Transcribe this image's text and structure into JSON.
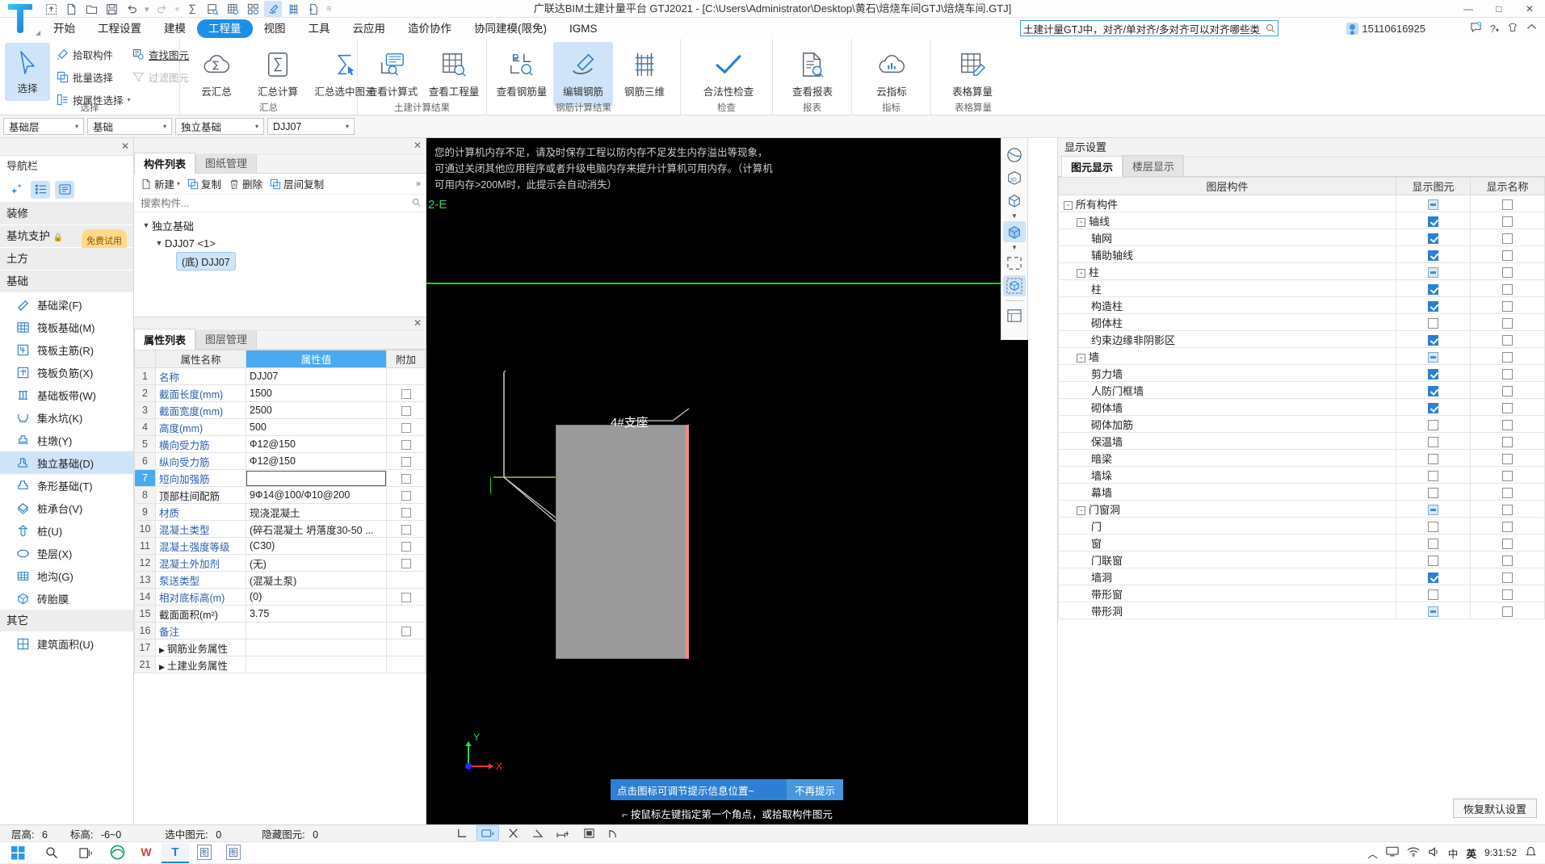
{
  "window": {
    "title": "广联达BIM土建计量平台 GTJ2021 - [C:\\Users\\Administrator\\Desktop\\黄石\\焙烧车间GTJ\\焙烧车间.GTJ]",
    "minimize": "—",
    "maximize": "□",
    "close": "✕"
  },
  "quick_access": {
    "icons": [
      "upload-icon",
      "new-file-icon",
      "open-folder-icon",
      "save-icon",
      "undo-icon",
      "redo-icon",
      "sum-icon",
      "calc-check-icon",
      "grid-search-icon",
      "layout-search-icon",
      "edit-rebar-icon",
      "rebar-3d-icon",
      "add-sheet-icon",
      "qat-more-icon"
    ]
  },
  "menu": {
    "items": [
      {
        "label": "开始",
        "active": false
      },
      {
        "label": "工程设置",
        "active": false
      },
      {
        "label": "建模",
        "active": false
      },
      {
        "label": "工程量",
        "active": true
      },
      {
        "label": "视图",
        "active": false
      },
      {
        "label": "工具",
        "active": false
      },
      {
        "label": "云应用",
        "active": false
      },
      {
        "label": "造价协作",
        "active": false
      },
      {
        "label": "协同建模(限免)",
        "active": false
      },
      {
        "label": "IGMS",
        "active": false
      }
    ]
  },
  "search": {
    "value": "土建计量GTJ中，对齐/单对齐/多对齐可以对齐哪些类型",
    "placeholder": "搜索"
  },
  "account": {
    "user_id": "15110616925"
  },
  "top_right_icons": [
    "message-icon",
    "help-icon",
    "shirt-icon",
    "collapse-ribbon-icon"
  ],
  "ribbon": {
    "groups": [
      {
        "title": "选择",
        "main": {
          "label": "选择",
          "icon": "cursor-arrow-icon",
          "selected": true
        },
        "items": [
          {
            "label": "拾取构件",
            "icon": "pick-component-icon",
            "disabled": false
          },
          {
            "label": "批量选择",
            "icon": "batch-select-icon",
            "disabled": false
          },
          {
            "label": "按属性选择",
            "icon": "select-by-property-icon",
            "disabled": false,
            "dropdown": true
          },
          {
            "label": "查找图元",
            "icon": "find-element-icon",
            "disabled": false
          },
          {
            "label": "过滤图元",
            "icon": "filter-element-icon",
            "disabled": true
          }
        ]
      },
      {
        "title": "汇总",
        "buttons": [
          {
            "label": "云汇总",
            "icon": "cloud-sum-icon",
            "selected": false
          },
          {
            "label": "汇总计算",
            "icon": "sum-calc-icon",
            "selected": false
          },
          {
            "label": "汇总选中图元",
            "icon": "sum-selected-icon",
            "selected": false
          }
        ]
      },
      {
        "title": "土建计算结果",
        "buttons": [
          {
            "label": "查看计算式",
            "icon": "view-formula-icon",
            "selected": false
          },
          {
            "label": "查看工程量",
            "icon": "view-quantity-icon",
            "selected": false
          }
        ]
      },
      {
        "title": "钢筋计算结果",
        "buttons": [
          {
            "label": "查看钢筋量",
            "icon": "view-rebar-qty-icon",
            "selected": false
          },
          {
            "label": "编辑钢筋",
            "icon": "edit-rebar-icon",
            "selected": true
          },
          {
            "label": "钢筋三维",
            "icon": "rebar-3d-icon",
            "selected": false
          }
        ]
      },
      {
        "title": "检查",
        "buttons": [
          {
            "label": "合法性检查",
            "icon": "check-mark-icon",
            "selected": false
          }
        ]
      },
      {
        "title": "报表",
        "buttons": [
          {
            "label": "查看报表",
            "icon": "view-report-icon",
            "selected": false
          }
        ]
      },
      {
        "title": "指标",
        "buttons": [
          {
            "label": "云指标",
            "icon": "cloud-indicator-icon",
            "selected": false
          }
        ]
      },
      {
        "title": "表格算量",
        "buttons": [
          {
            "label": "表格算量",
            "icon": "table-quantity-icon",
            "selected": false
          }
        ]
      }
    ]
  },
  "filter_bar": {
    "combos": [
      {
        "name": "floor",
        "value": "基础层"
      },
      {
        "name": "category",
        "value": "基础"
      },
      {
        "name": "component-type",
        "value": "独立基础"
      },
      {
        "name": "component-name",
        "value": "DJJ07"
      }
    ]
  },
  "nav_panel": {
    "title": "导航栏",
    "tools": [
      "sparkle-icon",
      "list-view-icon",
      "detail-view-icon"
    ],
    "groups": [
      {
        "label": "装修",
        "items": []
      },
      {
        "label": "基坑支护",
        "lock": true,
        "badge": "免费试用",
        "items": []
      },
      {
        "label": "土方",
        "items": []
      },
      {
        "label": "基础",
        "items": [
          {
            "label": "基础梁(F)",
            "icon": "foundation-beam-icon",
            "active": false
          },
          {
            "label": "筏板基础(M)",
            "icon": "raft-foundation-icon",
            "active": false
          },
          {
            "label": "筏板主筋(R)",
            "icon": "raft-main-rebar-icon",
            "active": false
          },
          {
            "label": "筏板负筋(X)",
            "icon": "raft-negative-rebar-icon",
            "active": false
          },
          {
            "label": "基础板带(W)",
            "icon": "foundation-slab-band-icon",
            "active": false
          },
          {
            "label": "集水坑(K)",
            "icon": "sump-pit-icon",
            "active": false
          },
          {
            "label": "柱墩(Y)",
            "icon": "column-pier-icon",
            "active": false
          },
          {
            "label": "独立基础(D)",
            "icon": "isolated-foundation-icon",
            "active": true
          },
          {
            "label": "条形基础(T)",
            "icon": "strip-foundation-icon",
            "active": false
          },
          {
            "label": "桩承台(V)",
            "icon": "pile-cap-icon",
            "active": false
          },
          {
            "label": "桩(U)",
            "icon": "pile-icon",
            "active": false
          },
          {
            "label": "垫层(X)",
            "icon": "cushion-layer-icon",
            "active": false
          },
          {
            "label": "地沟(G)",
            "icon": "trench-icon",
            "active": false
          },
          {
            "label": "砖胎膜",
            "icon": "brick-formwork-icon",
            "active": false
          }
        ]
      },
      {
        "label": "其它",
        "items": [
          {
            "label": "建筑面积(U)",
            "icon": "building-area-icon",
            "active": false
          }
        ]
      }
    ]
  },
  "component_panel": {
    "tabs": [
      {
        "label": "构件列表",
        "active": true
      },
      {
        "label": "图纸管理",
        "active": false
      }
    ],
    "toolbar": [
      {
        "label": "新建",
        "icon": "new-icon",
        "dropdown": true
      },
      {
        "label": "复制",
        "icon": "copy-icon"
      },
      {
        "label": "删除",
        "icon": "delete-icon"
      },
      {
        "label": "层间复制",
        "icon": "copy-between-floors-icon"
      }
    ],
    "search_placeholder": "搜索构件...",
    "tree": [
      {
        "label": "独立基础",
        "level": 0,
        "expanded": true
      },
      {
        "label": "DJJ07 <1>",
        "level": 1,
        "expanded": true
      },
      {
        "label": "(底) DJJ07",
        "level": 2,
        "selected": true
      }
    ]
  },
  "property_panel": {
    "tabs": [
      {
        "label": "属性列表",
        "active": true
      },
      {
        "label": "图层管理",
        "active": false
      }
    ],
    "headers": [
      "",
      "属性名称",
      "属性值",
      "附加"
    ],
    "rows": [
      {
        "idx": "1",
        "name": "名称",
        "value": "DJJ07",
        "attach": false,
        "show_attach": false,
        "bold_name": false
      },
      {
        "idx": "2",
        "name": "截面长度(mm)",
        "value": "1500",
        "attach": false,
        "show_attach": true
      },
      {
        "idx": "3",
        "name": "截面宽度(mm)",
        "value": "2500",
        "attach": false,
        "show_attach": true
      },
      {
        "idx": "4",
        "name": "高度(mm)",
        "value": "500",
        "attach": false,
        "show_attach": true
      },
      {
        "idx": "5",
        "name": "横向受力筋",
        "value": "Ф12@150",
        "attach": false,
        "show_attach": true
      },
      {
        "idx": "6",
        "name": "纵向受力筋",
        "value": "Ф12@150",
        "attach": false,
        "show_attach": true
      },
      {
        "idx": "7",
        "name": "短向加强筋",
        "value": "",
        "attach": false,
        "show_attach": true,
        "selected": true,
        "editing": true
      },
      {
        "idx": "8",
        "name": "顶部柱间配筋",
        "value": "9Ф14@100/Ф10@200",
        "attach": false,
        "show_attach": true,
        "plain": true
      },
      {
        "idx": "9",
        "name": "材质",
        "value": "现浇混凝土",
        "attach": false,
        "show_attach": true
      },
      {
        "idx": "10",
        "name": "混凝土类型",
        "value": "(碎石混凝土 坍落度30-50 ...",
        "attach": false,
        "show_attach": true
      },
      {
        "idx": "11",
        "name": "混凝土强度等级",
        "value": "(C30)",
        "attach": false,
        "show_attach": true
      },
      {
        "idx": "12",
        "name": "混凝土外加剂",
        "value": "(无)",
        "attach": false,
        "show_attach": true
      },
      {
        "idx": "13",
        "name": "泵送类型",
        "value": "(混凝土泵)",
        "attach": false,
        "show_attach": false
      },
      {
        "idx": "14",
        "name": "相对底标高(m)",
        "value": "(0)",
        "attach": false,
        "show_attach": true
      },
      {
        "idx": "15",
        "name": "截面面积(m²)",
        "value": "3.75",
        "attach": false,
        "show_attach": false,
        "plain": true
      },
      {
        "idx": "16",
        "name": "备注",
        "value": "",
        "attach": false,
        "show_attach": true
      },
      {
        "idx": "17",
        "name": "钢筋业务属性",
        "value": "",
        "attach": false,
        "show_attach": false,
        "group": true
      },
      {
        "idx": "21",
        "name": "土建业务属性",
        "value": "",
        "attach": false,
        "show_attach": false,
        "group": true
      }
    ]
  },
  "canvas": {
    "memory_warning": "您的计算机内存不足，请及时保存工程以防内存不足发生内存溢出等现象，可通过关闭其他应用程序或者升级电脑内存来提升计算机可用内存。（计算机可用内存>200M时，此提示会自动消失）",
    "axis_label": "2-E",
    "annotation": "4#支座",
    "axis_x": "X",
    "axis_y": "Y",
    "tip_text": "点击图标可调节提示信息位置~",
    "tip_dismiss": "不再提示",
    "status_hint": "按鼠标左键指定第一个角点，或拾取构件图元"
  },
  "view_tools": {
    "items": [
      {
        "icon": "orbit-icon",
        "on": false
      },
      {
        "icon": "view-3d-icon",
        "on": false
      },
      {
        "icon": "cube-outline-icon",
        "on": false
      },
      {
        "icon": "caret-down-icon",
        "on": false,
        "caret": true
      },
      {
        "icon": "cube-filled-icon",
        "on": true
      },
      {
        "icon": "caret-down-icon",
        "on": false,
        "caret": true
      },
      {
        "icon": "select-region-icon",
        "on": false
      },
      {
        "icon": "cube-dashed-icon",
        "on": true
      },
      {
        "icon": "list-panel-icon",
        "on": false
      }
    ]
  },
  "display_settings": {
    "title": "显示设置",
    "tabs": [
      {
        "label": "图元显示",
        "active": true
      },
      {
        "label": "楼层显示",
        "active": false
      }
    ],
    "headers": [
      "图层构件",
      "显示图元",
      "显示名称"
    ],
    "rows": [
      {
        "label": "所有构件",
        "level": 0,
        "toggle": "-",
        "show_element": "half",
        "show_name": "off"
      },
      {
        "label": "轴线",
        "level": 1,
        "toggle": "-",
        "show_element": "on",
        "show_name": "off"
      },
      {
        "label": "轴网",
        "level": 2,
        "toggle": "",
        "show_element": "on",
        "show_name": "off"
      },
      {
        "label": "辅助轴线",
        "level": 2,
        "toggle": "",
        "show_element": "on",
        "show_name": "off"
      },
      {
        "label": "柱",
        "level": 1,
        "toggle": "-",
        "show_element": "half",
        "show_name": "off"
      },
      {
        "label": "柱",
        "level": 2,
        "toggle": "",
        "show_element": "on",
        "show_name": "off"
      },
      {
        "label": "构造柱",
        "level": 2,
        "toggle": "",
        "show_element": "on",
        "show_name": "off"
      },
      {
        "label": "砌体柱",
        "level": 2,
        "toggle": "",
        "show_element": "off",
        "show_name": "off"
      },
      {
        "label": "约束边缘非阴影区",
        "level": 2,
        "toggle": "",
        "show_element": "on",
        "show_name": "off"
      },
      {
        "label": "墙",
        "level": 1,
        "toggle": "-",
        "show_element": "half",
        "show_name": "off"
      },
      {
        "label": "剪力墙",
        "level": 2,
        "toggle": "",
        "show_element": "on",
        "show_name": "off"
      },
      {
        "label": "人防门框墙",
        "level": 2,
        "toggle": "",
        "show_element": "on",
        "show_name": "off"
      },
      {
        "label": "砌体墙",
        "level": 2,
        "toggle": "",
        "show_element": "on",
        "show_name": "off"
      },
      {
        "label": "砌体加筋",
        "level": 2,
        "toggle": "",
        "show_element": "off",
        "show_name": "off"
      },
      {
        "label": "保温墙",
        "level": 2,
        "toggle": "",
        "show_element": "off",
        "show_name": "off"
      },
      {
        "label": "暗梁",
        "level": 2,
        "toggle": "",
        "show_element": "off",
        "show_name": "off"
      },
      {
        "label": "墙垛",
        "level": 2,
        "toggle": "",
        "show_element": "off",
        "show_name": "off"
      },
      {
        "label": "幕墙",
        "level": 2,
        "toggle": "",
        "show_element": "off",
        "show_name": "off"
      },
      {
        "label": "门窗洞",
        "level": 1,
        "toggle": "-",
        "show_element": "half",
        "show_name": "off"
      },
      {
        "label": "门",
        "level": 2,
        "toggle": "",
        "show_element": "off",
        "show_name": "off"
      },
      {
        "label": "窗",
        "level": 2,
        "toggle": "",
        "show_element": "off",
        "show_name": "off"
      },
      {
        "label": "门联窗",
        "level": 2,
        "toggle": "",
        "show_element": "off",
        "show_name": "off"
      },
      {
        "label": "墙洞",
        "level": 2,
        "toggle": "",
        "show_element": "on",
        "show_name": "off"
      },
      {
        "label": "带形窗",
        "level": 2,
        "toggle": "",
        "show_element": "off",
        "show_name": "off"
      },
      {
        "label": "带形洞",
        "level": 2,
        "toggle": "",
        "show_element": "half",
        "show_name": "off"
      }
    ],
    "restore_button": "恢复默认设置"
  },
  "status_bar": {
    "items": [
      {
        "label": "层高:",
        "value": "6"
      },
      {
        "label": "标高:",
        "value": "-6~0"
      },
      {
        "label": "选中图元:",
        "value": "0"
      },
      {
        "label": "隐藏图元:",
        "value": "0"
      }
    ],
    "tools": [
      "ortho-icon",
      "rect-select-icon",
      "close-x-icon",
      "angle-icon",
      "dimension-icon",
      "layer-icon",
      "arc-icon"
    ]
  },
  "taskbar": {
    "start_icon": "windows-start-icon",
    "search_icon": "search-icon",
    "taskview_icon": "task-view-icon",
    "apps": [
      {
        "icon": "edge-icon",
        "label": "e",
        "active": false
      },
      {
        "icon": "wps-icon",
        "label": "W",
        "active": false
      },
      {
        "icon": "glodon-icon",
        "label": "T",
        "active": true
      },
      {
        "icon": "app4-icon",
        "label": "图",
        "active": false
      },
      {
        "icon": "app5-icon",
        "label": "图",
        "active": false
      }
    ],
    "tray": [
      "caret-up-icon",
      "monitor-icon",
      "network-icon",
      "volume-icon",
      "ime-cn",
      "ime-en",
      "notification-icon"
    ],
    "ime_cn": "中",
    "ime_en": "英",
    "clock_time": "9:31:52"
  }
}
